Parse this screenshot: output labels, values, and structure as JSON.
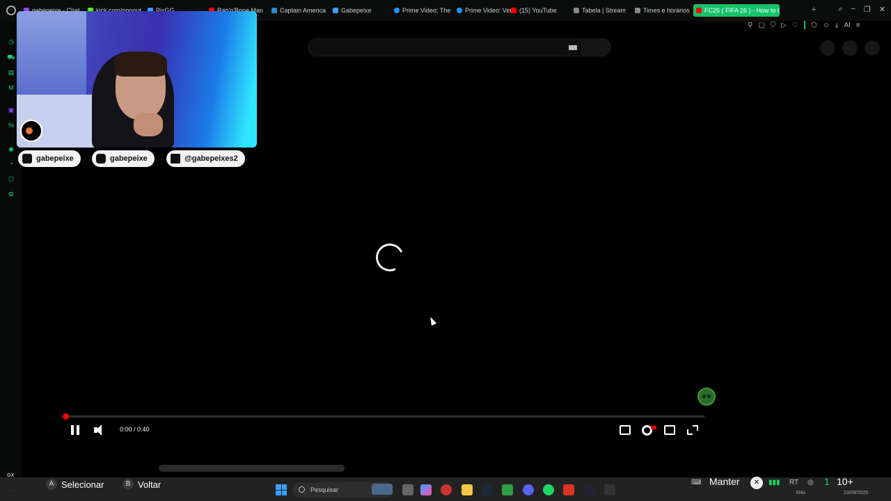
{
  "browser": {
    "tabs": [
      {
        "label": "gabepeixe - Chat",
        "color": "#9146ff"
      },
      {
        "label": "kick.com/popout",
        "color": "#53fc18"
      },
      {
        "label": "PixGG",
        "color": "#3aa0ff"
      },
      {
        "label": "Rag'n'Bone Man",
        "color": "#ff0000"
      },
      {
        "label": "Captain America",
        "color": "#2a8ad4"
      },
      {
        "label": "Gabepeixe",
        "color": "#3aa0ff"
      },
      {
        "label": "Prime Video: The",
        "color": "#1a98ff"
      },
      {
        "label": "Prime Video: Ver",
        "color": "#1a98ff"
      },
      {
        "label": "(15) YouTube",
        "color": "#ff0000"
      },
      {
        "label": "Tabela | Stream",
        "color": "#888888"
      },
      {
        "label": "Times e horários",
        "color": "#888888"
      },
      {
        "label": "FC26 ( FIFA 26 ) - How to G",
        "color": "#ff0000",
        "active": true
      }
    ],
    "new_tab": "+",
    "window_controls": [
      "−",
      "❐",
      "✕"
    ],
    "toolbar_ai": "AI"
  },
  "player": {
    "time_display": "0:00 / 0:40",
    "progress_fraction": 0.0,
    "accent": "#ff0000"
  },
  "overlay": {
    "socials": [
      {
        "platform": "youtube",
        "handle": "gabepeixe"
      },
      {
        "platform": "instagram",
        "handle": "gabepeixe"
      },
      {
        "platform": "tiktok",
        "handle": "@gabepeixes2"
      }
    ]
  },
  "gamebar": {
    "select_key": "A",
    "select_label": "Selecionar",
    "back_key": "B",
    "back_label": "Voltar",
    "keep_label": "Manter",
    "count_label": "10+",
    "num_one": "1"
  },
  "taskbar": {
    "search_placeholder": "Pesquisar",
    "lang": "ENG",
    "date": "23/09/2025"
  },
  "sidebar": {
    "gx_label": "GX"
  }
}
